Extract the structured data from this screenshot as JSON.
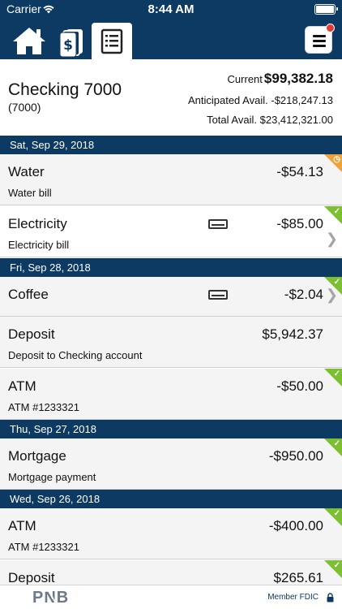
{
  "status_bar": {
    "carrier": "Carrier",
    "time": "8:44 AM"
  },
  "tabs": [
    {
      "icon": "home-icon"
    },
    {
      "icon": "money-icon"
    },
    {
      "icon": "register-icon",
      "selected": true
    }
  ],
  "menu": {
    "icon": "hamburger-menu-icon",
    "has_notification": true
  },
  "account": {
    "name": "Checking 7000",
    "number": "(7000)",
    "current_label": "Current",
    "current_value": "$99,382.18",
    "anticipated_label": "Anticipated Avail.",
    "anticipated_value": "-$218,247.13",
    "total_label": "Total Avail.",
    "total_value": "$23,412,321.00"
  },
  "groups": [
    {
      "date": "Sat, Sep 29, 2018",
      "transactions": [
        {
          "title": "Water",
          "subtitle": "Water bill",
          "amount": "-$54.13",
          "status": "pending"
        },
        {
          "title": "Electricity",
          "subtitle": "Electricity bill",
          "amount": "-$85.00",
          "status": "cleared",
          "card_icon": true,
          "chevron": true
        }
      ]
    },
    {
      "date": "Fri, Sep 28, 2018",
      "transactions": [
        {
          "title": "Coffee",
          "subtitle": "",
          "amount": "-$2.04",
          "status": "cleared",
          "card_icon": true,
          "chevron": true
        },
        {
          "title": "Deposit",
          "subtitle": "Deposit to Checking account",
          "amount": "$5,942.37",
          "status": "none"
        },
        {
          "title": "ATM",
          "subtitle": "ATM #1233321",
          "amount": "-$50.00",
          "status": "cleared"
        }
      ]
    },
    {
      "date": "Thu, Sep 27, 2018",
      "transactions": [
        {
          "title": "Mortgage",
          "subtitle": "Mortgage payment",
          "amount": "-$950.00",
          "status": "cleared"
        }
      ]
    },
    {
      "date": "Wed, Sep 26, 2018",
      "transactions": [
        {
          "title": "ATM",
          "subtitle": "ATM #1233321",
          "amount": "-$400.00",
          "status": "cleared"
        },
        {
          "title": "Deposit",
          "subtitle": "",
          "amount": "$265.61",
          "status": "cleared"
        }
      ]
    }
  ],
  "footer": {
    "logo_text": "PNB",
    "fdic": "Member FDIC"
  },
  "colors": {
    "navy": "#0d3a63",
    "cleared": "#7cbf31",
    "pending": "#f0a13a"
  }
}
